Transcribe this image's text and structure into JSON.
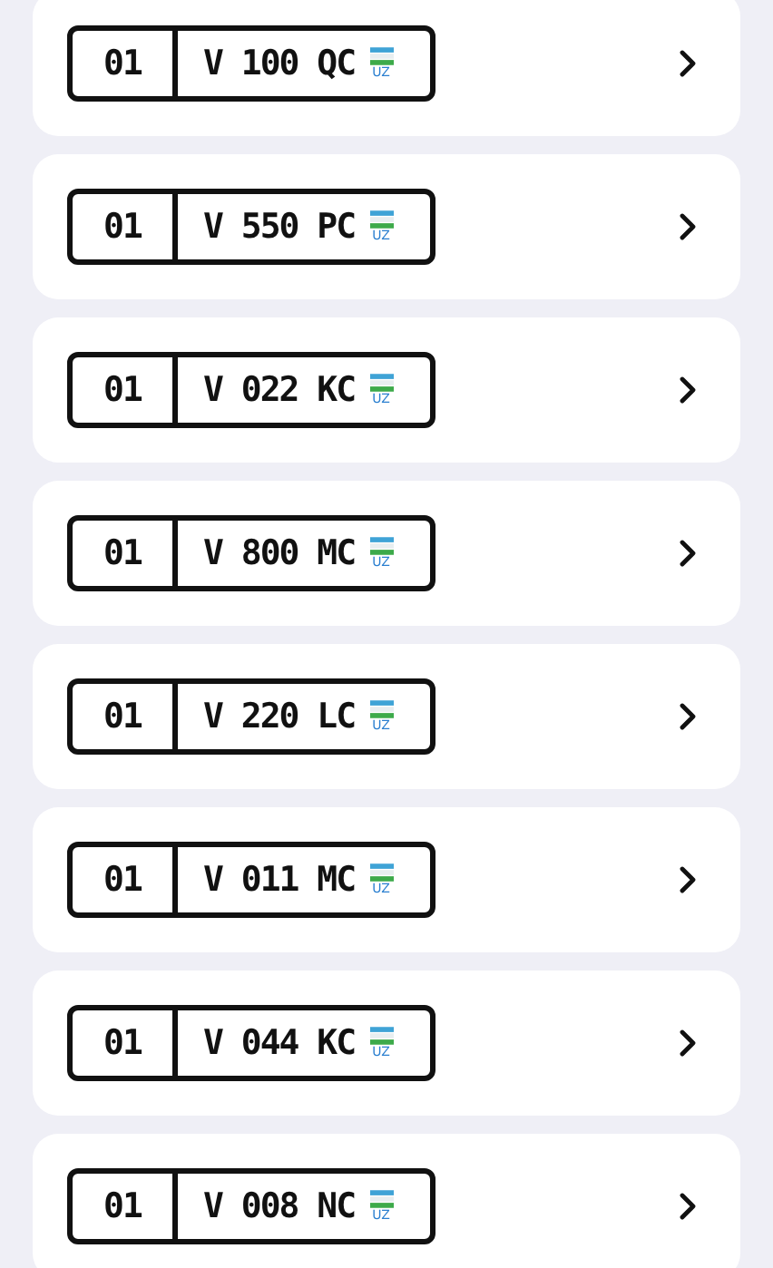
{
  "plates": [
    {
      "region": "01",
      "number": "V 100 QC",
      "country": "UZ"
    },
    {
      "region": "01",
      "number": "V 550 PC",
      "country": "UZ"
    },
    {
      "region": "01",
      "number": "V 022 KC",
      "country": "UZ"
    },
    {
      "region": "01",
      "number": "V 800 MC",
      "country": "UZ"
    },
    {
      "region": "01",
      "number": "V 220 LC",
      "country": "UZ"
    },
    {
      "region": "01",
      "number": "V 011 MC",
      "country": "UZ"
    },
    {
      "region": "01",
      "number": "V 044 KC",
      "country": "UZ"
    },
    {
      "region": "01",
      "number": "V 008 NC",
      "country": "UZ"
    }
  ]
}
